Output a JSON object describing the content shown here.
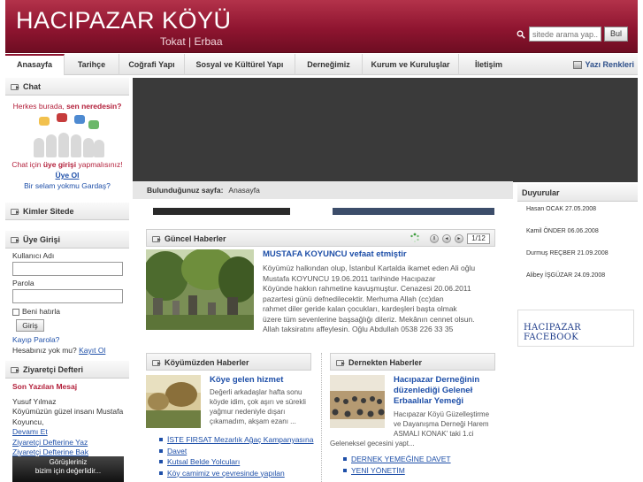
{
  "header": {
    "title": "HACIPAZAR KÖYÜ",
    "subtitle": "Tokat | Erbaa",
    "search_placeholder": "sitede arama yap...",
    "search_button": "Bul"
  },
  "nav": {
    "items": [
      "Anasayfa",
      "Tarihçe",
      "Coğrafi Yapı",
      "Sosyal ve Kültürel Yapı",
      "Derneğimiz",
      "Kurum ve Kuruluşlar",
      "İletişim"
    ],
    "theme_label": "Yazı Renkleri"
  },
  "chat": {
    "title": "Chat",
    "line1_a": "Herkes burada, ",
    "line1_b": "sen neredesin?",
    "line2_a": "Chat için ",
    "line2_b": "üye girişi",
    "line2_c": " yapmalısınız!",
    "register": "Üye Ol",
    "tagline": "Bir selam yokmu Gardaş?"
  },
  "online": {
    "title": "Kimler Sitede"
  },
  "login": {
    "title": "Üye Girişi",
    "username_label": "Kullanıcı Adı",
    "password_label": "Parola",
    "remember": "Beni hatırla",
    "submit": "Giriş",
    "forgot": "Kayıp Parola?",
    "no_account": "Hesabınız yok mu? ",
    "register_link": "Kayıt Ol"
  },
  "guestbook": {
    "title": "Ziyaretçi Defteri",
    "latest_label": "Son Yazılan Mesaj",
    "author": "Yusuf Yılmaz",
    "message_line1": "Köyümüzün güzel insanı Mustafa",
    "message_line2": "Koyuncu,",
    "more": "Devamı Et",
    "write": "Ziyaretçi Defterine Yaz",
    "view": "Ziyaretçi Defterine Bak",
    "promo_line1": "Görüşleriniz",
    "promo_line2": "bizim için değerlidir..."
  },
  "breadcrumb": {
    "label": "Bulunduğunuz sayfa:",
    "current": "Anasayfa"
  },
  "current_news": {
    "title": "Güncel Haberler",
    "pager": "1/12",
    "headline": "MUSTAFA KOYUNCU vefaat etmiştir",
    "lines": [
      "Köyümüz halkından olup, İstanbul Kartalda ikamet eden Ali oğlu",
      "Mustafa KOYUNCU 19.06.2011 tarihinde Hacıpazar",
      "Köyünde hakkın rahmetine kavuşmuştur. Cenazesi 20.06.2011",
      "pazartesi günü defnedilecektir. Merhuma Allah (cc)dan",
      "rahmet diler geride kalan çocukları, kardeşleri başta olmak",
      "üzere tüm sevenlerine başsağlığı dileriz. Mekânın cennet olsun.",
      "Allah taksiratını affeylesin. Oğlu Abdullah 0538 226 33 35"
    ]
  },
  "village_news": {
    "title": "Köyümüzden Haberler",
    "headline": "Köye gelen hizmet",
    "lines": [
      "Değerli arkadaşlar hafta sonu",
      "köyde idim, çok aşırı ve sürekli",
      "yağmur nedeniyle dışarı",
      "çıkamadım, akşam ezanı ..."
    ],
    "links": [
      "İSTE FIRSAT Mezarlık Ağaç Kampanyasına",
      "Davet",
      "Kutsal Belde Yolcuları",
      "Köy camimiz ve çevresinde yapılan"
    ]
  },
  "assoc_news": {
    "title": "Dernekten Haberler",
    "headline_line1": "Hacıpazar Derneğinin",
    "headline_line2": "düzenlediği Geleneł",
    "headline_line3": "Erbaalılar Yemeği",
    "lines": [
      "Hacıpazar Köyü Güzelleştirme",
      "ve Dayanışma Derneği Harem",
      "ASMALI KONAK' taki 1.ci",
      "Geleneksel gecesini yapt..."
    ],
    "links": [
      "DERNEK YEMEĞİNE DAVET",
      "YENİ YÖNETİM"
    ]
  },
  "announcements": {
    "title": "Duyurular",
    "items": [
      "Hasan OCAK 27.05.2008",
      "Kamil ÖNDER 06.06.2008",
      "Durmuş REÇBER 21.09.2008",
      "Alibey İŞGÜZAR 24.09.2008"
    ]
  },
  "facebook": {
    "label": "HACIPAZAR FACEBOOK"
  }
}
